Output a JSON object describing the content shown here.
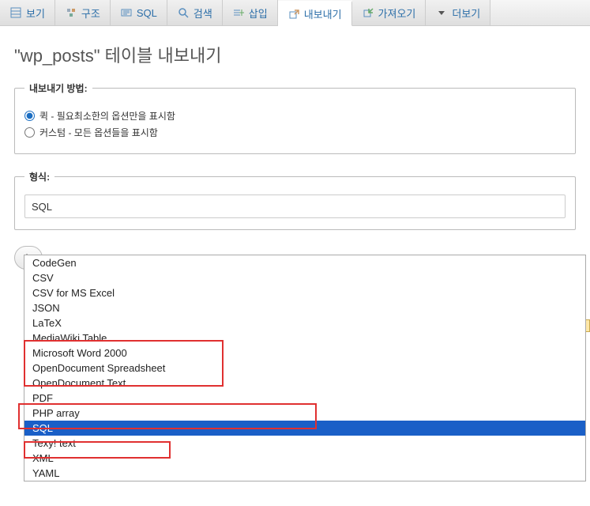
{
  "tabs": [
    {
      "label": "보기",
      "icon": "table-icon"
    },
    {
      "label": "구조",
      "icon": "structure-icon"
    },
    {
      "label": "SQL",
      "icon": "sql-icon"
    },
    {
      "label": "검색",
      "icon": "search-icon"
    },
    {
      "label": "삽입",
      "icon": "insert-icon"
    },
    {
      "label": "내보내기",
      "icon": "export-icon",
      "active": true
    },
    {
      "label": "가져오기",
      "icon": "import-icon"
    },
    {
      "label": "더보기",
      "icon": "more-icon"
    }
  ],
  "page_title": "\"wp_posts\" 테이블 내보내기",
  "export_method": {
    "legend": "내보내기 방법:",
    "options": [
      {
        "label": "퀵 - 필요최소한의 옵션만을 표시함",
        "checked": true
      },
      {
        "label": "커스텀 - 모든 옵션들을 표시함",
        "checked": false
      }
    ]
  },
  "format": {
    "legend": "형식:",
    "selected": "SQL",
    "options": [
      "CodeGen",
      "CSV",
      "CSV for MS Excel",
      "JSON",
      "LaTeX",
      "MediaWiki Table",
      "Microsoft Word 2000",
      "OpenDocument Spreadsheet",
      "OpenDocument Text",
      "PDF",
      "PHP array",
      "SQL",
      "Texy! text",
      "XML",
      "YAML"
    ]
  },
  "go_button": "L"
}
